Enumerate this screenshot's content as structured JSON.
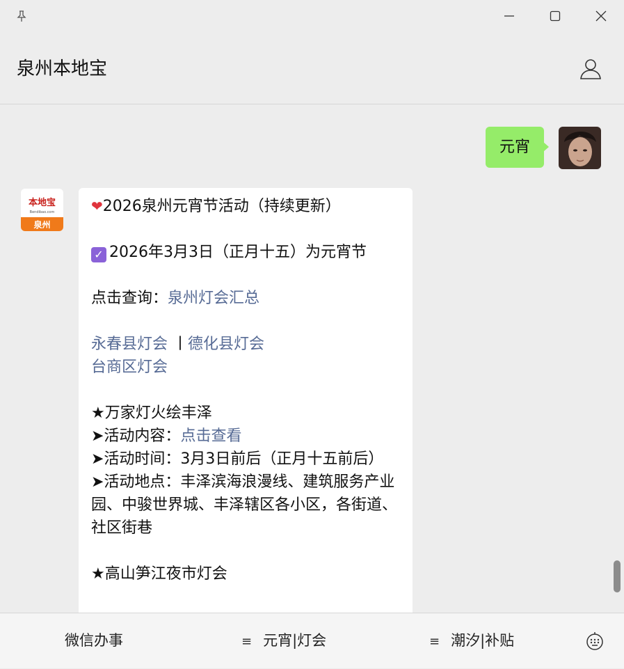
{
  "window": {
    "title": "泉州本地宝",
    "controls": [
      "pin-icon",
      "minimize-icon",
      "maximize-icon",
      "close-icon"
    ]
  },
  "chat": {
    "sent_message": "元宵",
    "received": {
      "logo_text_top": "本地宝",
      "logo_text_sub": "Bendibao.com",
      "logo_text_bottom": "泉州",
      "lines": {
        "l1": "2026泉州元宵节活动（持续更新）",
        "l2": "2026年3月3日（正月十五）为元宵节",
        "l3_prefix": "点击查询：",
        "l3_link": "泉州灯会汇总",
        "l4_link1": "永春县灯会",
        "l4_sep": " 丨",
        "l4_link2": "德化县灯会",
        "l5_link": "台商区灯会",
        "l6": "★万家灯火绘丰泽",
        "l7_prefix": "➤活动内容：",
        "l7_link": "点击查看",
        "l8": "➤活动时间：3月3日前后（正月十五前后）",
        "l9": "➤活动地点：丰泽滨海浪漫线、建筑服务产业园、中骏世界城、丰泽辖区各小区，各街道、社区街巷",
        "l10": "★高山笋江夜市灯会"
      }
    }
  },
  "bottom_menu": {
    "item1": "微信办事",
    "item2": "元宵|灯会",
    "item3": "潮汐|补贴",
    "menu_icon": "≡"
  },
  "colors": {
    "background": "#ededed",
    "sent_bubble": "#95ec69",
    "received_bubble": "#ffffff",
    "link": "#576b95",
    "logo_orange": "#f07a1a",
    "check_purple": "#8a62d8"
  }
}
